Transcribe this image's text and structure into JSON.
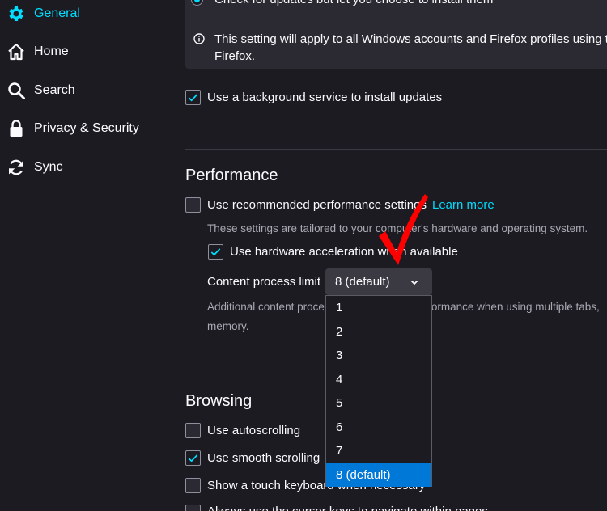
{
  "sidebar": {
    "items": [
      {
        "label": "General",
        "icon": "gear-icon"
      },
      {
        "label": "Home",
        "icon": "home-icon"
      },
      {
        "label": "Search",
        "icon": "search-icon"
      },
      {
        "label": "Privacy & Security",
        "icon": "lock-icon"
      },
      {
        "label": "Sync",
        "icon": "sync-icon"
      }
    ]
  },
  "updates": {
    "radio_label": "Check for updates but let you choose to install them",
    "info_line1": "This setting will apply to all Windows accounts and Firefox profiles using th",
    "info_line2": "Firefox.",
    "background_service_label": "Use a background service to install updates"
  },
  "performance": {
    "heading": "Performance",
    "recommended_label": "Use recommended performance settings",
    "learn_more": "Learn more",
    "recommended_desc": "These settings are tailored to your computer's hardware and operating system.",
    "hw_accel_label": "Use hardware acceleration when available",
    "content_process_label": "Content process limit",
    "content_process_value": "8 (default)",
    "additional_desc_line1": "Additional content processes can improve performance when using multiple tabs,",
    "additional_desc_line2": "memory.",
    "options": [
      "1",
      "2",
      "3",
      "4",
      "5",
      "6",
      "7",
      "8 (default)"
    ]
  },
  "browsing": {
    "heading": "Browsing",
    "autoscroll_label": "Use autoscrolling",
    "smooth_label": "Use smooth scrolling",
    "touch_kb_label": "Show a touch keyboard when necessary",
    "cursor_keys_label": "Always use the cursor keys to navigate within pages"
  },
  "colors": {
    "accent": "#00ddff",
    "annotation": "#ff0000",
    "selected_option": "#0078d7"
  }
}
